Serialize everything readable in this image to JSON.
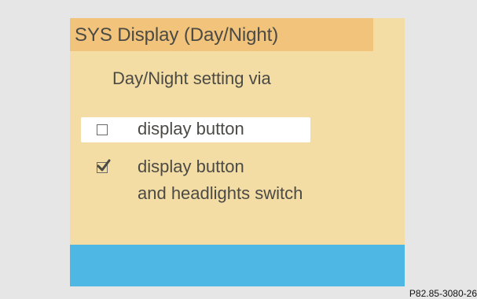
{
  "panel": {
    "title": "SYS Display (Day/Night)",
    "subtitle": "Day/Night setting via",
    "options": [
      {
        "label": "display button",
        "checked": false
      },
      {
        "label_line1": "display button",
        "label_line2": "and headlights switch",
        "checked": true
      }
    ]
  },
  "caption": "P82.85-3080-26",
  "colors": {
    "page_background": "#e6e6e6",
    "panel_background": "#f3dda4",
    "title_bar": "#f2c37b",
    "footer_bar": "#4fb7e3",
    "highlight": "#ffffff",
    "text": "#4b4a45"
  },
  "icons": {
    "unchecked": "checkbox-empty-icon",
    "checked": "checkbox-checked-icon"
  }
}
